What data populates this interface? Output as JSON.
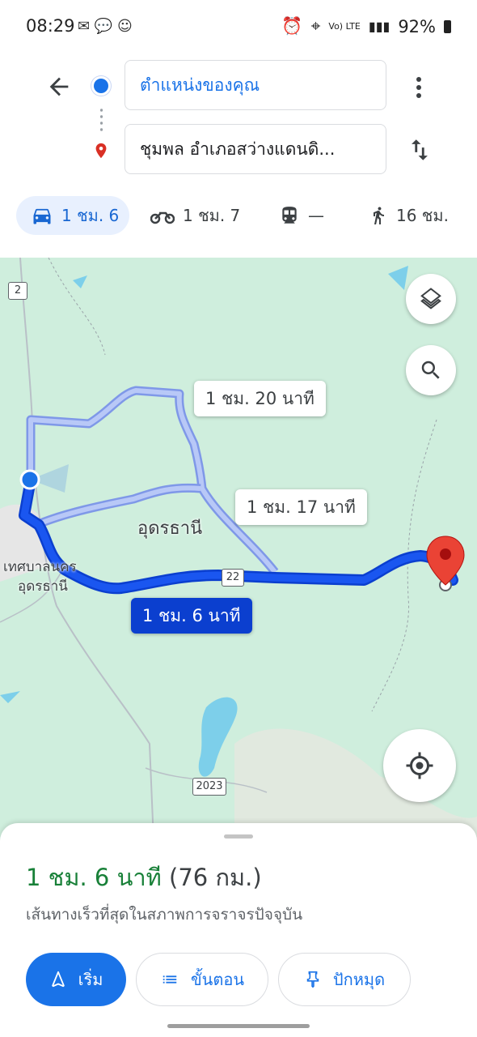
{
  "status_bar": {
    "time": "08:29",
    "battery": "92%",
    "network": "Vo) LTE"
  },
  "directions": {
    "origin": "ตำแหน่งของคุณ",
    "destination": "ชุมพล อำเภอสว่างแดนดิ...",
    "modes": [
      {
        "icon": "car-icon",
        "label": "1 ชม. 6",
        "selected": true
      },
      {
        "icon": "motorcycle-icon",
        "label": "1 ชม. 7",
        "selected": false
      },
      {
        "icon": "train-icon",
        "label": "—",
        "selected": false
      },
      {
        "icon": "walk-icon",
        "label": "16 ชม.",
        "selected": false
      }
    ]
  },
  "map": {
    "route_labels": {
      "alt1": "1 ชม. 20 นาที",
      "alt2": "1 ชม. 17 นาที",
      "main": "1 ชม. 6 นาที"
    },
    "places": {
      "city": "อุดรธานี",
      "municipality_line1": "เทศบาลนคร",
      "municipality_line2": "อุดรธานี"
    },
    "road_shields": {
      "r2": "2",
      "r22": "22",
      "r2023": "2023"
    },
    "colors": {
      "route_primary": "#1a56f0",
      "route_alt": "#9fb4f5",
      "map_bg": "#cfeedd",
      "water": "#7dcfea"
    }
  },
  "sheet": {
    "duration": "1 ชม. 6 นาที",
    "distance": "(76 กม.)",
    "description": "เส้นทางเร็วที่สุดในสภาพการจราจรปัจจุบัน",
    "buttons": {
      "start": "เริ่ม",
      "steps": "ขั้นตอน",
      "pin": "ปักหมุด"
    }
  }
}
